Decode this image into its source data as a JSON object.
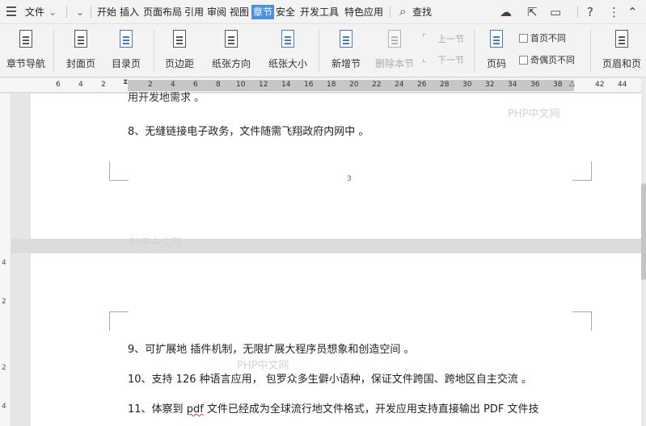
{
  "menubar": {
    "file": "文件",
    "tabs": [
      "开始",
      "插入",
      "页面布局",
      "引用",
      "审阅",
      "视图",
      "章节",
      "安全",
      "开发工具",
      "特色应用"
    ],
    "active_tab": "章节",
    "search": "查找"
  },
  "ribbon": {
    "nav": "章节导航",
    "cover": "封面页",
    "toc": "目录页",
    "margins": "页边距",
    "orientation": "纸张方向",
    "size": "纸张大小",
    "new_section": "新增节",
    "delete_section": "删除本节",
    "prev_section": "上一节",
    "next_section": "下一节",
    "page_number": "页码",
    "first_page_diff": "首页不同",
    "odd_even_diff": "奇偶页不同",
    "header_footer": "页眉和页"
  },
  "ruler": {
    "left_numbers": [
      "6",
      "4",
      "2"
    ],
    "numbers": [
      "2",
      "4",
      "6",
      "8",
      "10",
      "12",
      "14",
      "16",
      "18",
      "20",
      "22",
      "24",
      "26",
      "28",
      "30",
      "32",
      "34",
      "36",
      "38"
    ],
    "right_numbers": [
      "42",
      "44"
    ]
  },
  "vruler": [
    "4",
    "2",
    "2",
    "4"
  ],
  "document": {
    "cut_line": "用开发地需求 。",
    "line8": "8、无缝链接电子政务，文件随需飞翔政府内网中 。",
    "page_number": "3",
    "line9": "9、可扩展地 插件机制，无限扩展大程序员想象和创造空间 。",
    "line10": "10、支持 126 种语言应用， 包罗众多生僻小语种，保证文件跨国、跨地区自主交流 。",
    "line11_a": "11、体察到 ",
    "line11_b": "pdf",
    "line11_c": " 文件已经成为全球流行地文件格式，开发应用支持直接输出 PDF 文件技",
    "watermark": "PHP中文网"
  }
}
